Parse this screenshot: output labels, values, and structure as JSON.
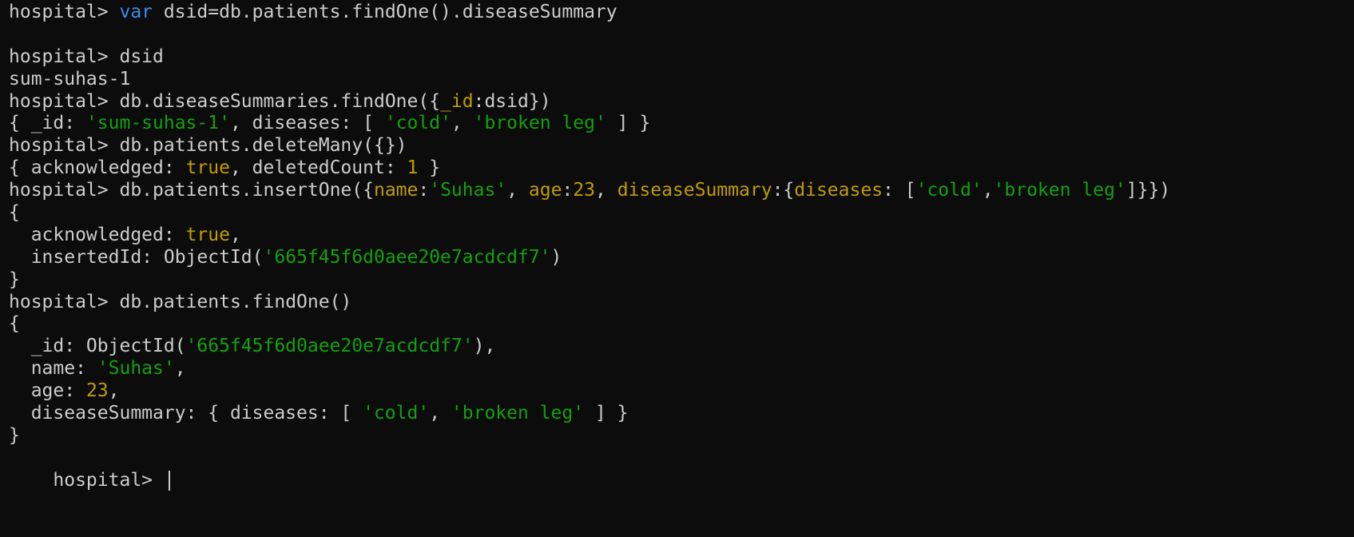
{
  "terminal": {
    "colors": {
      "background": "#0c0c0c",
      "foreground": "#cccccc",
      "keyword": "#3b8eea",
      "string": "#13a10e",
      "number": "#c19c00"
    },
    "lines": [
      [
        {
          "cls": "prompt",
          "text": "hospital> "
        },
        {
          "cls": "tok-keyword",
          "text": "var"
        },
        {
          "cls": "tok-plain",
          "text": " dsid=db.patients.findOne().diseaseSummary"
        }
      ],
      [],
      [
        {
          "cls": "prompt",
          "text": "hospital> "
        },
        {
          "cls": "tok-plain",
          "text": "dsid"
        }
      ],
      [
        {
          "cls": "tok-plain",
          "text": "sum-suhas-1"
        }
      ],
      [
        {
          "cls": "prompt",
          "text": "hospital> "
        },
        {
          "cls": "tok-plain",
          "text": "db.diseaseSummaries.findOne({"
        },
        {
          "cls": "tok-field",
          "text": "_id"
        },
        {
          "cls": "tok-plain",
          "text": ":dsid})"
        }
      ],
      [
        {
          "cls": "tok-plain",
          "text": "{ _id: "
        },
        {
          "cls": "tok-string",
          "text": "'sum-suhas-1'"
        },
        {
          "cls": "tok-plain",
          "text": ", diseases: [ "
        },
        {
          "cls": "tok-string",
          "text": "'cold'"
        },
        {
          "cls": "tok-plain",
          "text": ", "
        },
        {
          "cls": "tok-string",
          "text": "'broken leg'"
        },
        {
          "cls": "tok-plain",
          "text": " ] }"
        }
      ],
      [
        {
          "cls": "prompt",
          "text": "hospital> "
        },
        {
          "cls": "tok-plain",
          "text": "db.patients.deleteMany({})"
        }
      ],
      [
        {
          "cls": "tok-plain",
          "text": "{ acknowledged: "
        },
        {
          "cls": "tok-bool",
          "text": "true"
        },
        {
          "cls": "tok-plain",
          "text": ", deletedCount: "
        },
        {
          "cls": "tok-number",
          "text": "1"
        },
        {
          "cls": "tok-plain",
          "text": " }"
        }
      ],
      [
        {
          "cls": "prompt",
          "text": "hospital> "
        },
        {
          "cls": "tok-plain",
          "text": "db.patients.insertOne({"
        },
        {
          "cls": "tok-field",
          "text": "name"
        },
        {
          "cls": "tok-plain",
          "text": ":"
        },
        {
          "cls": "tok-string",
          "text": "'Suhas'"
        },
        {
          "cls": "tok-plain",
          "text": ", "
        },
        {
          "cls": "tok-field",
          "text": "age"
        },
        {
          "cls": "tok-plain",
          "text": ":"
        },
        {
          "cls": "tok-number",
          "text": "23"
        },
        {
          "cls": "tok-plain",
          "text": ", "
        },
        {
          "cls": "tok-field",
          "text": "diseaseSummary"
        },
        {
          "cls": "tok-plain",
          "text": ":{"
        },
        {
          "cls": "tok-field",
          "text": "diseases"
        },
        {
          "cls": "tok-plain",
          "text": ": ["
        },
        {
          "cls": "tok-string",
          "text": "'cold'"
        },
        {
          "cls": "tok-plain",
          "text": ","
        },
        {
          "cls": "tok-string",
          "text": "'broken leg'"
        },
        {
          "cls": "tok-plain",
          "text": "]}})"
        }
      ],
      [
        {
          "cls": "tok-plain",
          "text": "{"
        }
      ],
      [
        {
          "cls": "tok-plain",
          "text": "  acknowledged: "
        },
        {
          "cls": "tok-bool",
          "text": "true"
        },
        {
          "cls": "tok-plain",
          "text": ","
        }
      ],
      [
        {
          "cls": "tok-plain",
          "text": "  insertedId: ObjectId("
        },
        {
          "cls": "tok-string",
          "text": "'665f45f6d0aee20e7acdcdf7'"
        },
        {
          "cls": "tok-plain",
          "text": ")"
        }
      ],
      [
        {
          "cls": "tok-plain",
          "text": "}"
        }
      ],
      [
        {
          "cls": "prompt",
          "text": "hospital> "
        },
        {
          "cls": "tok-plain",
          "text": "db.patients.findOne()"
        }
      ],
      [
        {
          "cls": "tok-plain",
          "text": "{"
        }
      ],
      [
        {
          "cls": "tok-plain",
          "text": "  _id: ObjectId("
        },
        {
          "cls": "tok-string",
          "text": "'665f45f6d0aee20e7acdcdf7'"
        },
        {
          "cls": "tok-plain",
          "text": "),"
        }
      ],
      [
        {
          "cls": "tok-plain",
          "text": "  name: "
        },
        {
          "cls": "tok-string",
          "text": "'Suhas'"
        },
        {
          "cls": "tok-plain",
          "text": ","
        }
      ],
      [
        {
          "cls": "tok-plain",
          "text": "  age: "
        },
        {
          "cls": "tok-number",
          "text": "23"
        },
        {
          "cls": "tok-plain",
          "text": ","
        }
      ],
      [
        {
          "cls": "tok-plain",
          "text": "  diseaseSummary: { diseases: [ "
        },
        {
          "cls": "tok-string",
          "text": "'cold'"
        },
        {
          "cls": "tok-plain",
          "text": ", "
        },
        {
          "cls": "tok-string",
          "text": "'broken leg'"
        },
        {
          "cls": "tok-plain",
          "text": " ] }"
        }
      ],
      [
        {
          "cls": "tok-plain",
          "text": "}"
        }
      ]
    ],
    "current_prompt": "hospital> "
  }
}
